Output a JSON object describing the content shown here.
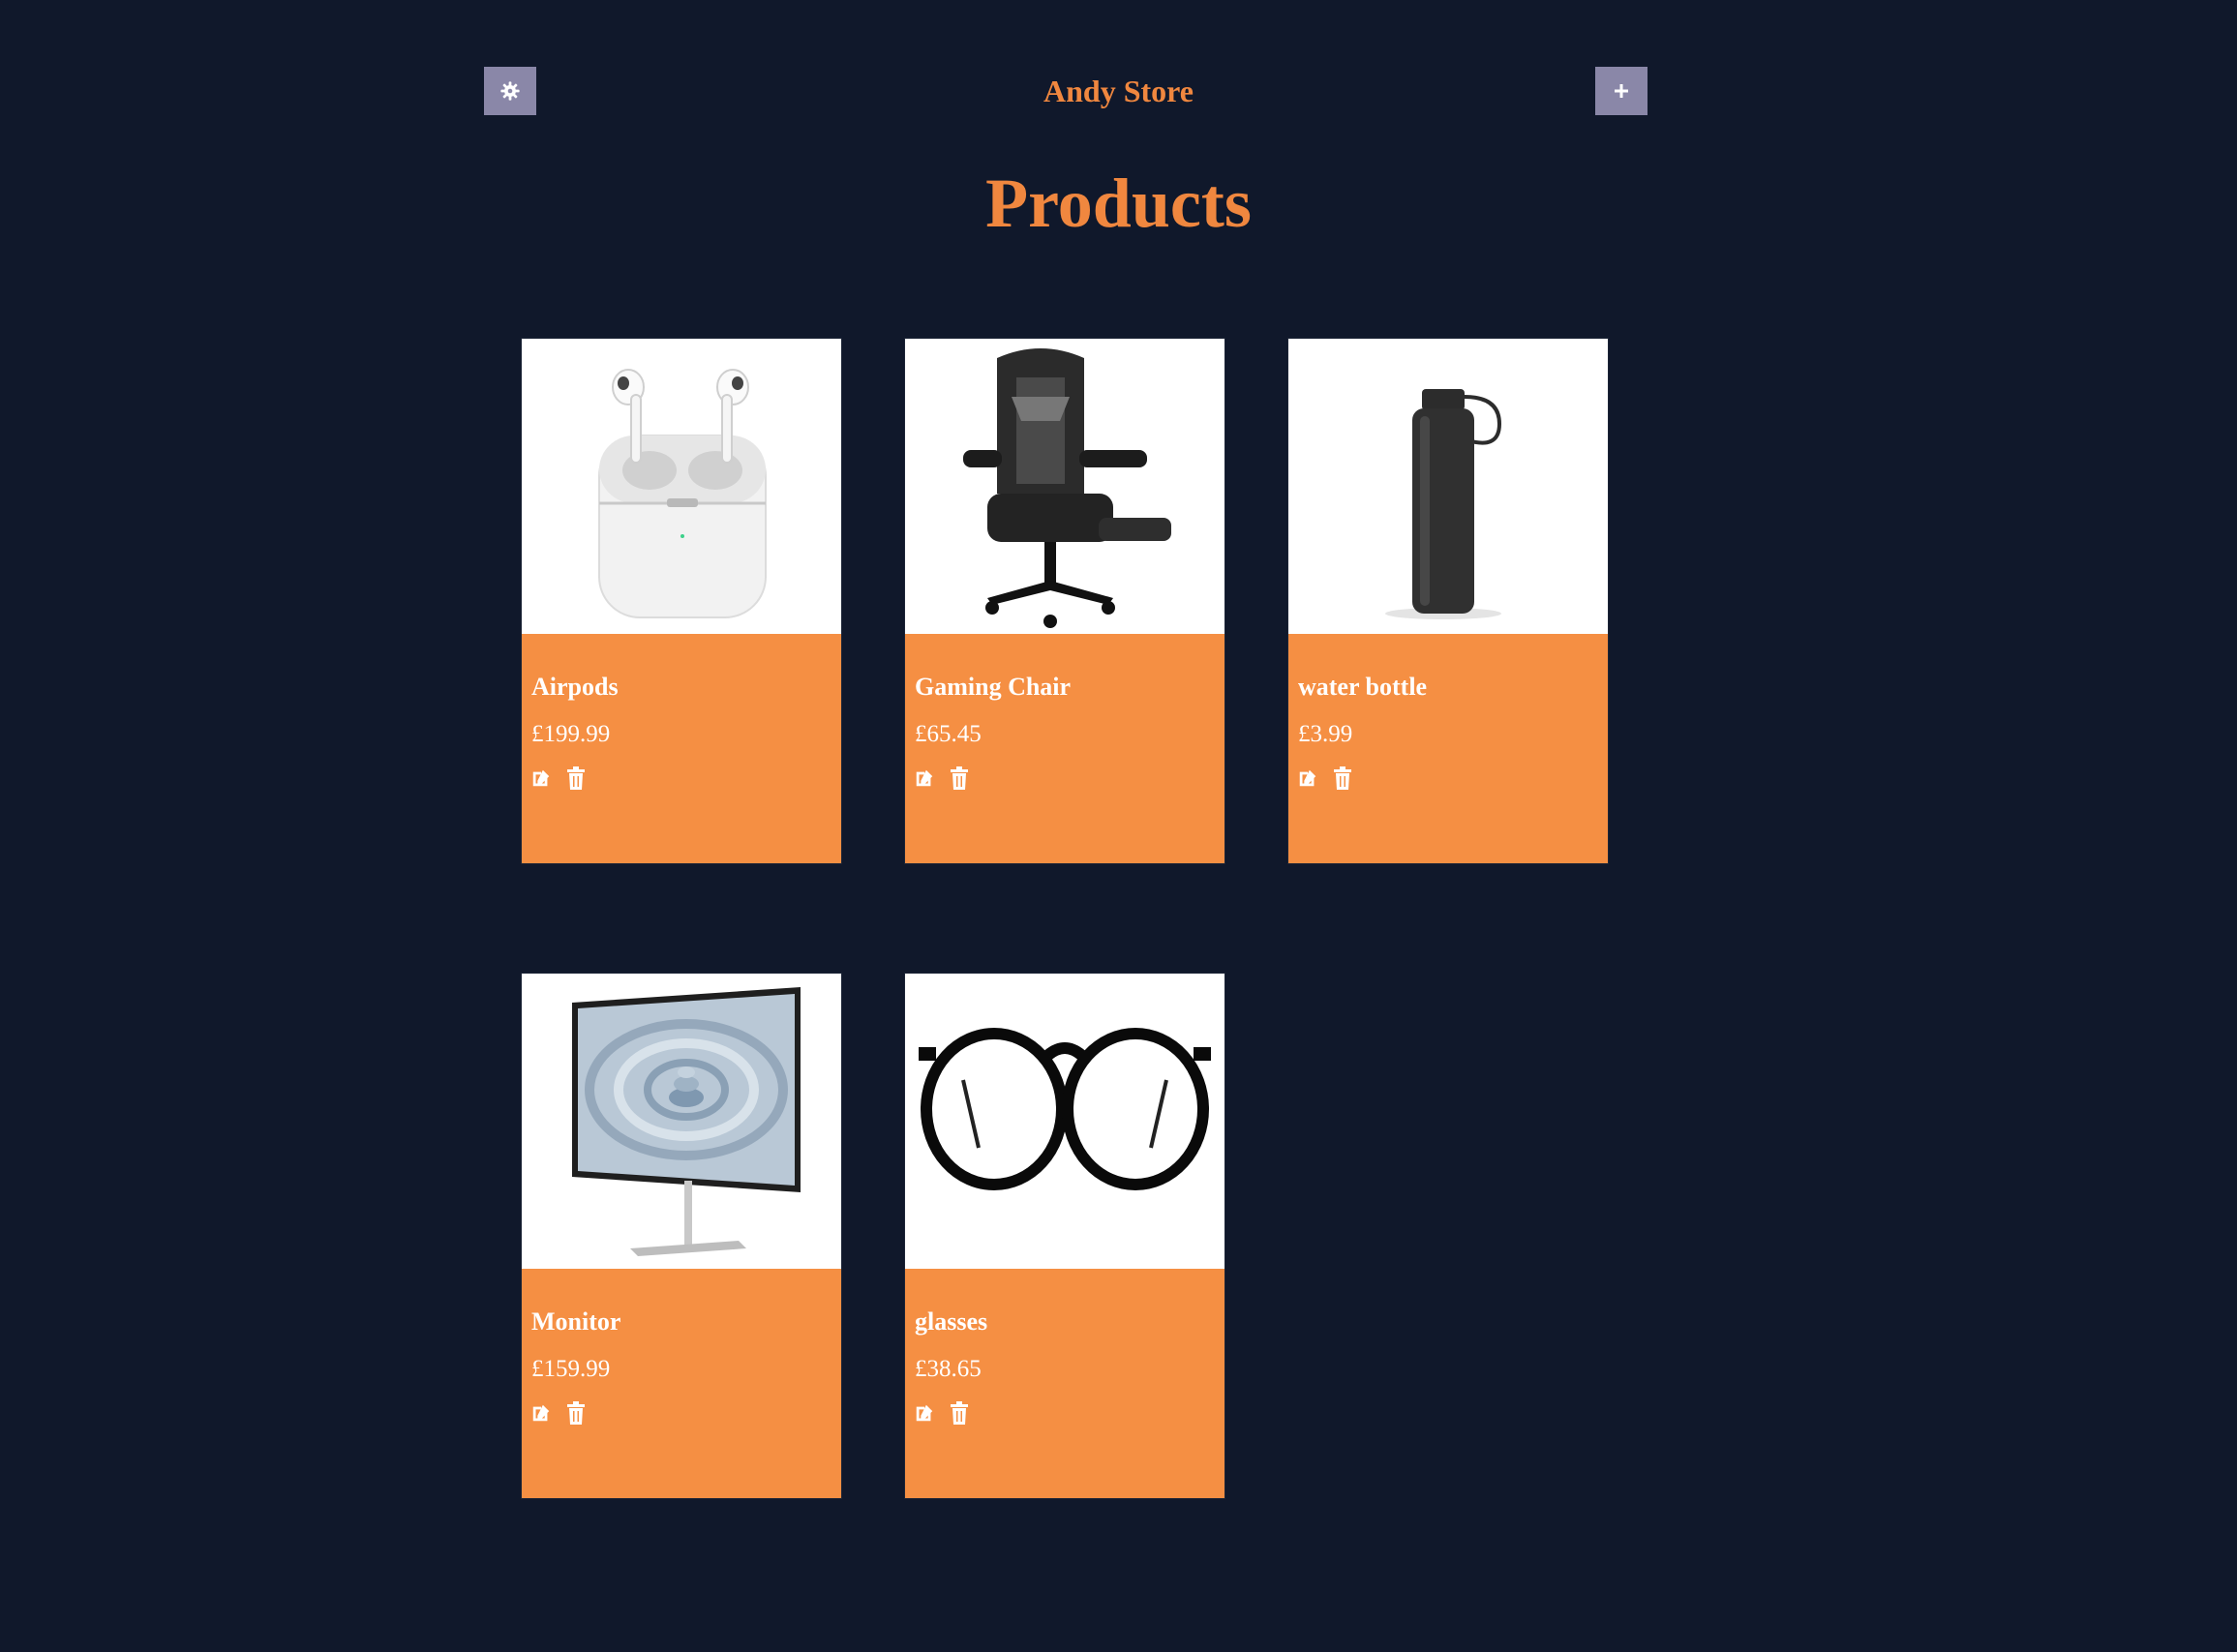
{
  "header": {
    "brand": "Andy Store",
    "settings_icon": "gear-icon",
    "add_icon": "plus-icon"
  },
  "page": {
    "title": "Products"
  },
  "colors": {
    "background": "#10182b",
    "accent": "#f0873f",
    "card": "#f58f43",
    "icon_button": "#8a87a8"
  },
  "products": [
    {
      "name": "Airpods",
      "price": "£199.99",
      "image": "airpods-image"
    },
    {
      "name": "Gaming Chair",
      "price": "£65.45",
      "image": "gaming-chair-image"
    },
    {
      "name": "water bottle",
      "price": "£3.99",
      "image": "water-bottle-image"
    },
    {
      "name": "Monitor",
      "price": "£159.99",
      "image": "monitor-image"
    },
    {
      "name": "glasses",
      "price": "£38.65",
      "image": "glasses-image"
    }
  ],
  "actions": {
    "edit_icon": "edit-icon",
    "delete_icon": "trash-icon"
  }
}
